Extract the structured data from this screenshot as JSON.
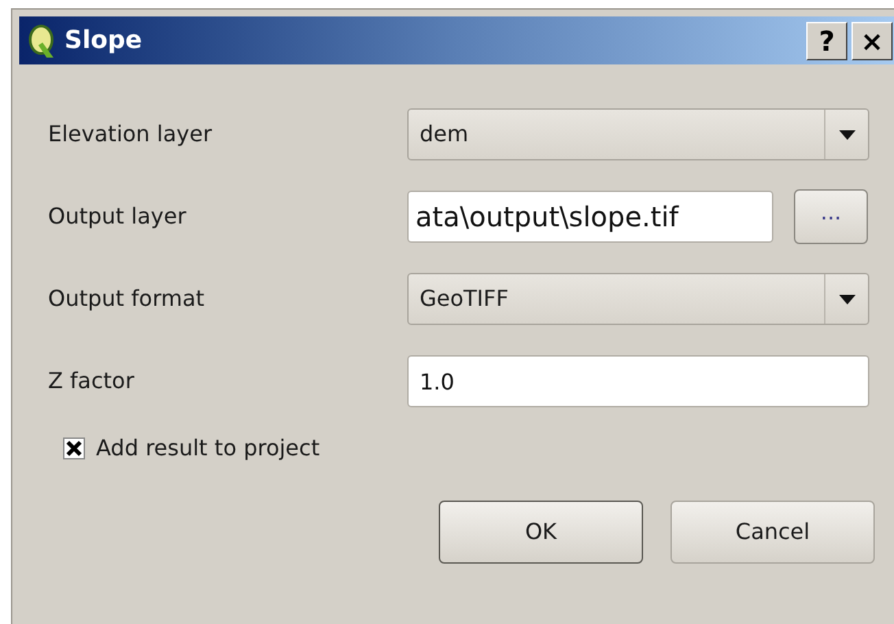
{
  "window": {
    "title": "Slope"
  },
  "title_buttons": [
    "?",
    "×"
  ],
  "rows": [
    {
      "kind": "combo",
      "label": "Elevation layer",
      "value": "dem"
    },
    {
      "kind": "file",
      "label": "Output layer",
      "value": "ata\\output\\slope.tif",
      "button": "..."
    },
    {
      "kind": "combo",
      "label": "Output format",
      "value": "GeoTIFF"
    },
    {
      "kind": "text",
      "label": "Z factor",
      "value": "1.0"
    }
  ],
  "add_to_project": {
    "label": "Add result to project",
    "checked": true
  },
  "buttons": [
    {
      "label": "OK",
      "default": true
    },
    {
      "label": "Cancel",
      "default": false
    }
  ]
}
